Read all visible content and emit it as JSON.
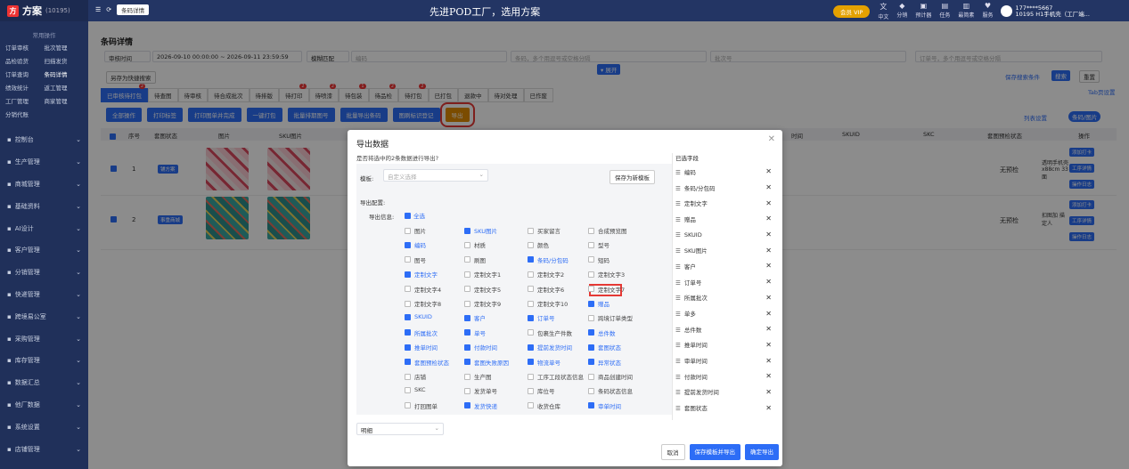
{
  "app": {
    "logo": "方案",
    "count": "(10195)",
    "tag": "条码详情",
    "slogan": "先进POD工厂，选用方案",
    "vip": "会员 VIP",
    "user_phone": "177****5667",
    "user_org": "10195 H1手机壳（工厂端..."
  },
  "topicons": [
    {
      "label": "中文",
      "icon": "文"
    },
    {
      "label": "分销",
      "icon": "◆"
    },
    {
      "label": "预计器",
      "icon": "▣"
    },
    {
      "label": "任务",
      "icon": "▤"
    },
    {
      "label": "最简素",
      "icon": "▥"
    },
    {
      "label": "服务",
      "icon": "♥"
    }
  ],
  "sidebar": {
    "section": "常用操作",
    "quick": [
      "订单审核",
      "批次管理",
      "品检验货",
      "扫描发货",
      "订单查询",
      "条码详情",
      "绩效统计",
      "返工管理",
      "工厂管理",
      "商家管理",
      "分销代账"
    ],
    "menu": [
      "控制台",
      "生产管理",
      "商城管理",
      "基础资料",
      "AI设计",
      "客户管理",
      "分销管理",
      "快递管理",
      "跨境易公室",
      "采购管理",
      "库存管理",
      "数据汇总",
      "他厂数据",
      "系统设置",
      "店铺管理"
    ]
  },
  "page": {
    "title": "条码详情",
    "date_type": "审核时间",
    "date_from": "2026-09-10 00:00:00",
    "date_to": "2026-09-11 23:59:59",
    "match": "模糊匹配",
    "ph_code": "编码",
    "ph_sku": "条码，多个用逗号或空格分隔",
    "ph_batch": "批次号",
    "ph_order": "订单号，多个用逗号或空格分隔",
    "expand": "▾ 展开",
    "save_q": "另存为快捷搜索",
    "save_cond": "保存搜索条件",
    "search": "搜索",
    "reset": "重置",
    "tab_setting": "Tab页设置",
    "list_setting": "列表设置",
    "toggle": "条码/图片"
  },
  "tabs": [
    {
      "label": "已审核待打包",
      "badge": "2"
    },
    {
      "label": "待查图",
      "badge": ""
    },
    {
      "label": "待审核",
      "badge": ""
    },
    {
      "label": "待合成批次",
      "badge": ""
    },
    {
      "label": "待排版",
      "badge": ""
    },
    {
      "label": "待打印",
      "badge": "2"
    },
    {
      "label": "待喷漆",
      "badge": "2"
    },
    {
      "label": "待包装",
      "badge": "1"
    },
    {
      "label": "待品检",
      "badge": "2"
    },
    {
      "label": "待打包",
      "badge": "2"
    },
    {
      "label": "已打包",
      "badge": ""
    },
    {
      "label": "退款中",
      "badge": ""
    },
    {
      "label": "待对处理",
      "badge": ""
    },
    {
      "label": "已作废",
      "badge": ""
    }
  ],
  "actions": [
    "全部操作",
    "打印标签",
    "打印图单并完成",
    "一键打包",
    "批量排期图号",
    "批量导出条码",
    "图刷标识登记",
    "导出"
  ],
  "table": {
    "headers": [
      "序号",
      "套图状态",
      "图片",
      "SKU图片",
      "时间",
      "SKUID",
      "SKC",
      "套图预检状态",
      "操作"
    ],
    "rows": [
      {
        "no": "1",
        "status": "铺方案",
        "pre": "无预检",
        "extra": "透明手机壳 x88cm 33 面",
        "ops": [
          "添加打卡",
          "工序详情",
          "操作日志"
        ]
      },
      {
        "no": "2",
        "status": "事重商城",
        "pre": "无预检",
        "extra": "扣图加 描定人",
        "ops": [
          "添加打卡",
          "工序详情",
          "操作日志"
        ]
      }
    ]
  },
  "modal": {
    "title": "导出数据",
    "subtitle": "是否将选中的2条数据进行导出?",
    "template_label": "模板:",
    "template_ph": "自定义选择",
    "save_template": "保存为新模板",
    "config_label": "导出配置:",
    "info_label": "导出信息:",
    "all": "全选",
    "format": "明细",
    "cancel": "取消",
    "save_export": "保存模板并导出",
    "confirm": "确定导出",
    "selected_title": "已选字段",
    "options": [
      [
        {
          "t": "图片",
          "on": false
        },
        {
          "t": "SKU图片",
          "on": true
        },
        {
          "t": "买家留言",
          "on": false
        },
        {
          "t": "合成预览图",
          "on": false
        }
      ],
      [
        {
          "t": "编码",
          "on": true
        },
        {
          "t": "材质",
          "on": false
        },
        {
          "t": "颜色",
          "on": false
        },
        {
          "t": "型号",
          "on": false
        }
      ],
      [
        {
          "t": "图号",
          "on": false
        },
        {
          "t": "刷图",
          "on": false
        },
        {
          "t": "条码/分包码",
          "on": true
        },
        {
          "t": "短码",
          "on": false
        }
      ],
      [
        {
          "t": "定制文字",
          "on": true
        },
        {
          "t": "定制文字1",
          "on": false
        },
        {
          "t": "定制文字2",
          "on": false
        },
        {
          "t": "定制文字3",
          "on": false
        }
      ],
      [
        {
          "t": "定制文字4",
          "on": false
        },
        {
          "t": "定制文字5",
          "on": false
        },
        {
          "t": "定制文字6",
          "on": false
        },
        {
          "t": "定制文字7",
          "on": false
        }
      ],
      [
        {
          "t": "定制文字8",
          "on": false
        },
        {
          "t": "定制文字9",
          "on": false
        },
        {
          "t": "定制文字10",
          "on": false
        },
        {
          "t": "赠品",
          "on": true
        }
      ],
      [
        {
          "t": "SKUID",
          "on": true
        },
        {
          "t": "客户",
          "on": true
        },
        {
          "t": "订单号",
          "on": true
        },
        {
          "t": "跨境订单类型",
          "on": false
        }
      ],
      [
        {
          "t": "所属批次",
          "on": true
        },
        {
          "t": "单号",
          "on": true
        },
        {
          "t": "包裹生产件数",
          "on": false
        },
        {
          "t": "总件数",
          "on": true
        }
      ],
      [
        {
          "t": "推单时间",
          "on": true
        },
        {
          "t": "付款时间",
          "on": true
        },
        {
          "t": "提前发货时间",
          "on": true
        },
        {
          "t": "套图状态",
          "on": true
        }
      ],
      [
        {
          "t": "套图预检状态",
          "on": true
        },
        {
          "t": "套图失败原因",
          "on": true
        },
        {
          "t": "物流单号",
          "on": true
        },
        {
          "t": "异常状态",
          "on": true
        }
      ],
      [
        {
          "t": "店铺",
          "on": false
        },
        {
          "t": "生产图",
          "on": false
        },
        {
          "t": "工序工段状态信息",
          "on": false
        },
        {
          "t": "商品创建时间",
          "on": false
        }
      ],
      [
        {
          "t": "SKC",
          "on": false
        },
        {
          "t": "发货单号",
          "on": false
        },
        {
          "t": "库位号",
          "on": false
        },
        {
          "t": "条码状态信息",
          "on": false
        }
      ],
      [
        {
          "t": "打回图单",
          "on": false
        },
        {
          "t": "发货快递",
          "on": true
        },
        {
          "t": "收货仓库",
          "on": false
        },
        {
          "t": "审单时间",
          "on": true
        }
      ]
    ],
    "selected": [
      "编码",
      "条码/分包码",
      "定制文字",
      "赠品",
      "SKUID",
      "SKU图片",
      "客户",
      "订单号",
      "所属批次",
      "单多",
      "总件数",
      "推单时间",
      "审单时间",
      "付款时间",
      "提前发货时间",
      "套图状态"
    ]
  }
}
